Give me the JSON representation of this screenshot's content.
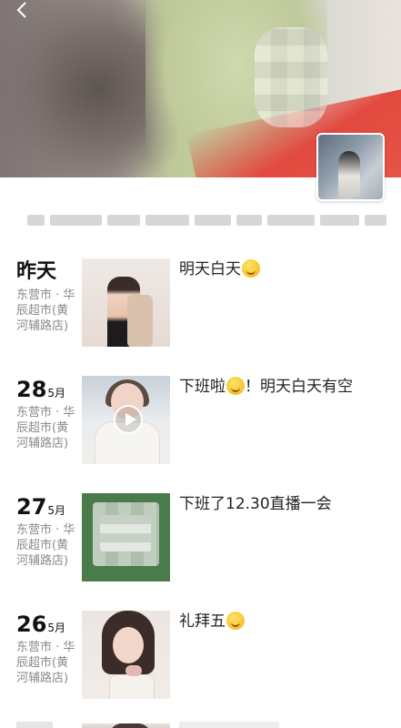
{
  "header": {
    "back_icon": "chevron-left-icon",
    "avatar": "user-avatar"
  },
  "posts": [
    {
      "day": "昨天",
      "month": "",
      "location": "东营市 · 华辰超市(黄河辅路店)",
      "caption": "明天白天",
      "emoji": "smile-emoji",
      "media": "photo"
    },
    {
      "day": "28",
      "month": "5月",
      "location": "东营市 · 华辰超市(黄河辅路店)",
      "caption": "下班啦",
      "caption_after": "！明天白天有空",
      "emoji": "wink-emoji",
      "media": "video"
    },
    {
      "day": "27",
      "month": "5月",
      "location": "东营市 · 华辰超市(黄河辅路店)",
      "caption": "下班了12.30直播一会",
      "emoji": "",
      "media": "image"
    },
    {
      "day": "26",
      "month": "5月",
      "location": "东营市 · 华辰超市(黄河辅路店)",
      "caption": "礼拜五",
      "emoji": "smile-emoji",
      "media": "photo"
    }
  ]
}
